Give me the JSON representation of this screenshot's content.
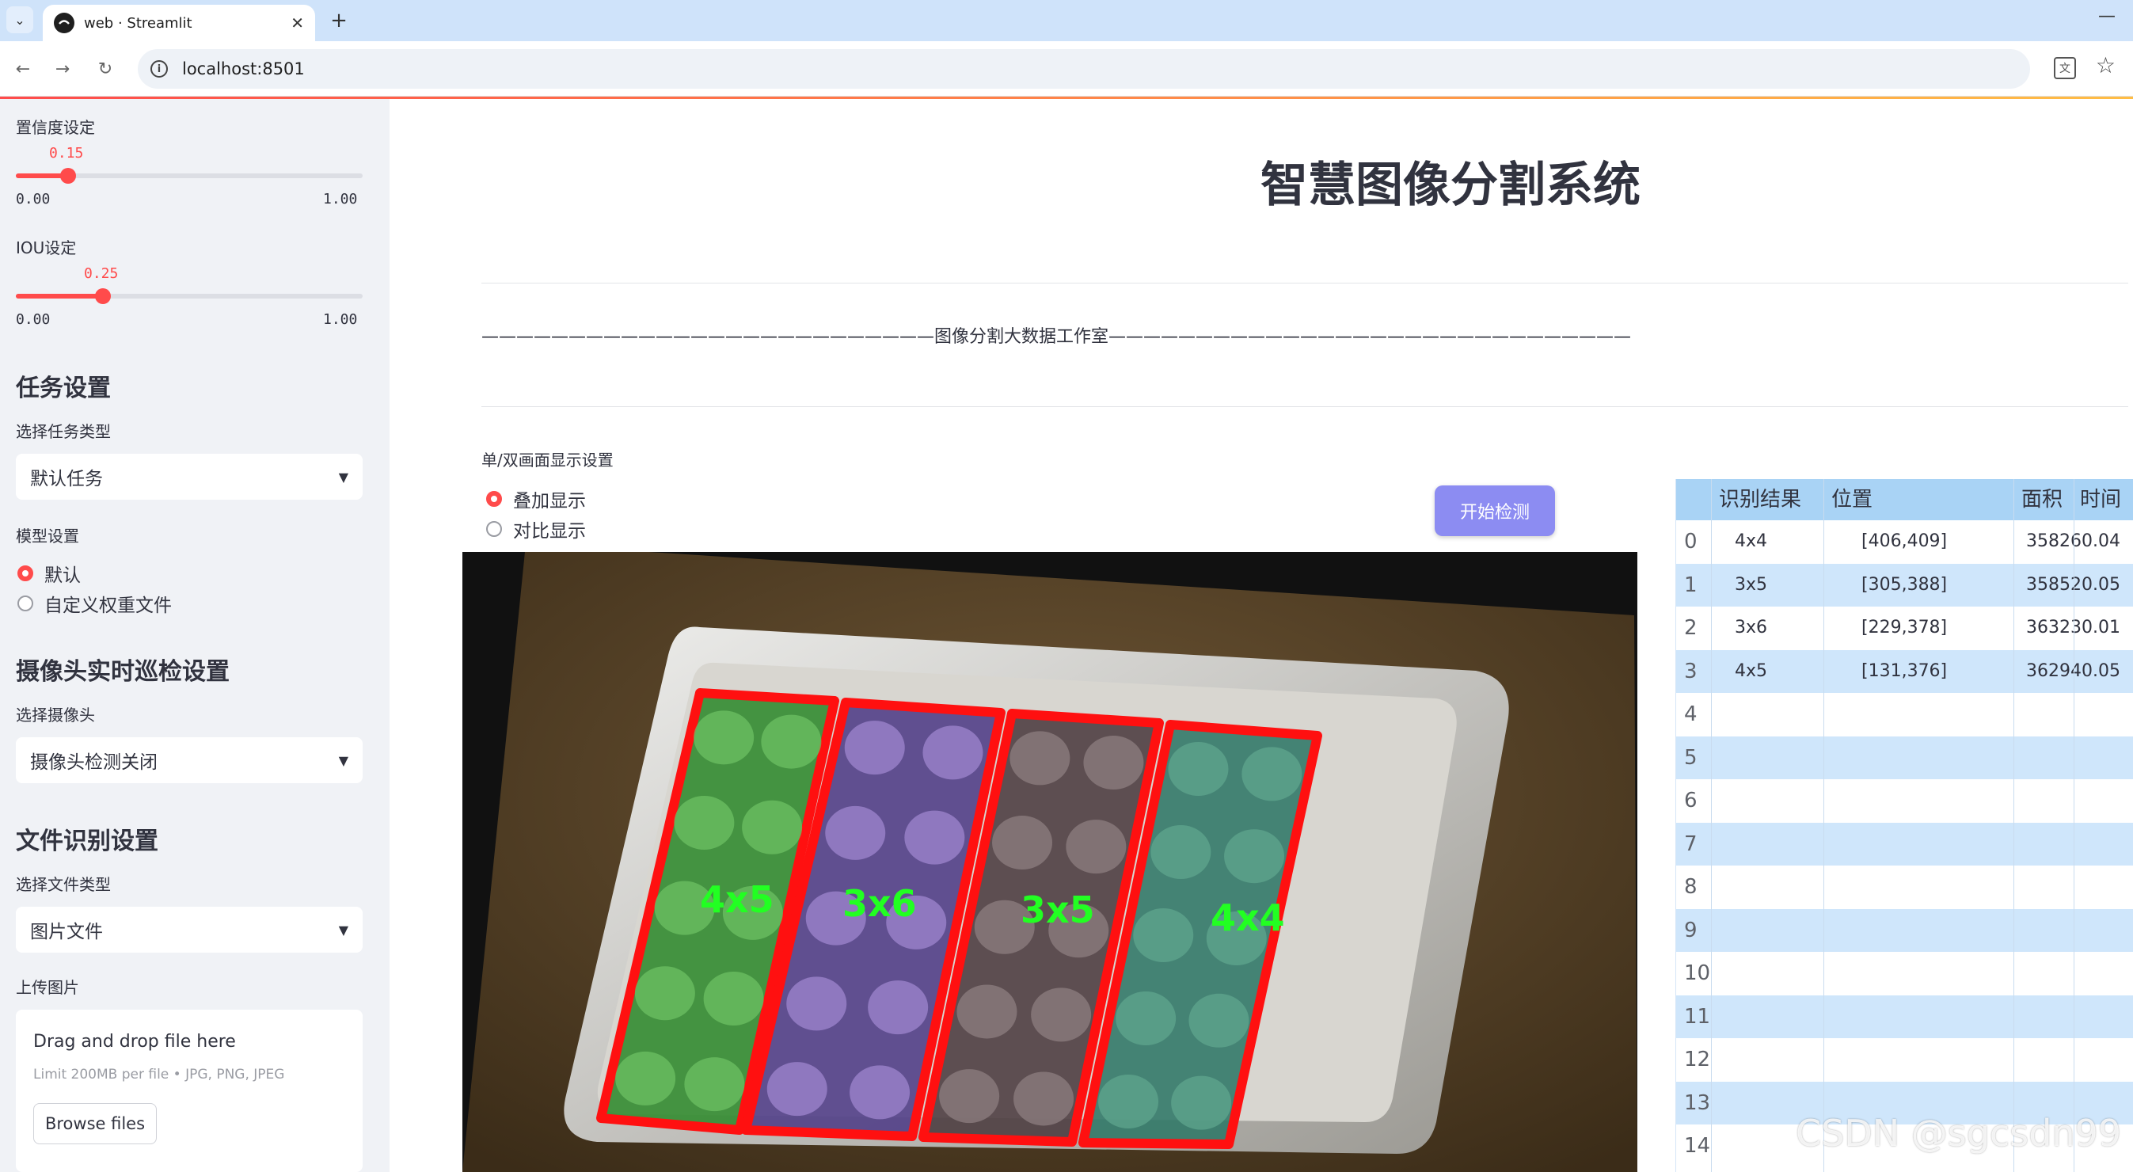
{
  "browser": {
    "tab_title": "web · Streamlit",
    "url": "localhost:8501"
  },
  "sidebar": {
    "confidence": {
      "label": "置信度设定",
      "value": "0.15",
      "fraction": 0.15,
      "min": "0.00",
      "max": "1.00"
    },
    "iou": {
      "label": "IOU设定",
      "value": "0.25",
      "fraction": 0.25,
      "min": "0.00",
      "max": "1.00"
    },
    "task": {
      "heading": "任务设置",
      "select_label": "选择任务类型",
      "selected": "默认任务"
    },
    "model": {
      "label": "模型设置",
      "options": [
        "默认",
        "自定义权重文件"
      ],
      "selected_index": 0
    },
    "camera": {
      "heading": "摄像头实时巡检设置",
      "select_label": "选择摄像头",
      "selected": "摄像头检测关闭"
    },
    "file": {
      "heading": "文件识别设置",
      "select_label": "选择文件类型",
      "selected": "图片文件"
    },
    "upload": {
      "label": "上传图片",
      "title": "Drag and drop file here",
      "limit": "Limit 200MB per file • JPG, PNG, JPEG",
      "button": "Browse files"
    }
  },
  "main": {
    "title": "智慧图像分割系统",
    "subtitle": "——————————————————————————图像分割大数据工作室——————————————————————————————",
    "display_mode": {
      "label": "单/双画面显示设置",
      "options": [
        "叠加显示",
        "对比显示"
      ],
      "selected_index": 0
    },
    "start_button": "开始检测",
    "detections": [
      "4x5",
      "3x6",
      "3x5",
      "4x4"
    ]
  },
  "table": {
    "headers": [
      "识别结果",
      "位置",
      "面积",
      "时间"
    ],
    "rows": [
      {
        "idx": "0",
        "result": "4x4",
        "pos": "[406,409]",
        "area": "35826",
        "time": "0.04"
      },
      {
        "idx": "1",
        "result": "3x5",
        "pos": "[305,388]",
        "area": "35852",
        "time": "0.05"
      },
      {
        "idx": "2",
        "result": "3x6",
        "pos": "[229,378]",
        "area": "36323",
        "time": "0.01"
      },
      {
        "idx": "3",
        "result": "4x5",
        "pos": "[131,376]",
        "area": "36294",
        "time": "0.05"
      },
      {
        "idx": "4",
        "result": "",
        "pos": "",
        "area": "",
        "time": ""
      },
      {
        "idx": "5",
        "result": "",
        "pos": "",
        "area": "",
        "time": ""
      },
      {
        "idx": "6",
        "result": "",
        "pos": "",
        "area": "",
        "time": ""
      },
      {
        "idx": "7",
        "result": "",
        "pos": "",
        "area": "",
        "time": ""
      },
      {
        "idx": "8",
        "result": "",
        "pos": "",
        "area": "",
        "time": ""
      },
      {
        "idx": "9",
        "result": "",
        "pos": "",
        "area": "",
        "time": ""
      },
      {
        "idx": "10",
        "result": "",
        "pos": "",
        "area": "",
        "time": ""
      },
      {
        "idx": "11",
        "result": "",
        "pos": "",
        "area": "",
        "time": ""
      },
      {
        "idx": "12",
        "result": "",
        "pos": "",
        "area": "",
        "time": ""
      },
      {
        "idx": "13",
        "result": "",
        "pos": "",
        "area": "",
        "time": ""
      },
      {
        "idx": "14",
        "result": "",
        "pos": "",
        "area": "",
        "time": ""
      }
    ]
  },
  "watermark": "CSDN @sgcsdn99",
  "colors": {
    "accent": "#ff4b4b",
    "sidebar_bg": "#f0f2f6",
    "button": "#8c8cf2",
    "table_header": "#a9d3f5",
    "table_alt": "#cfe6fb"
  }
}
